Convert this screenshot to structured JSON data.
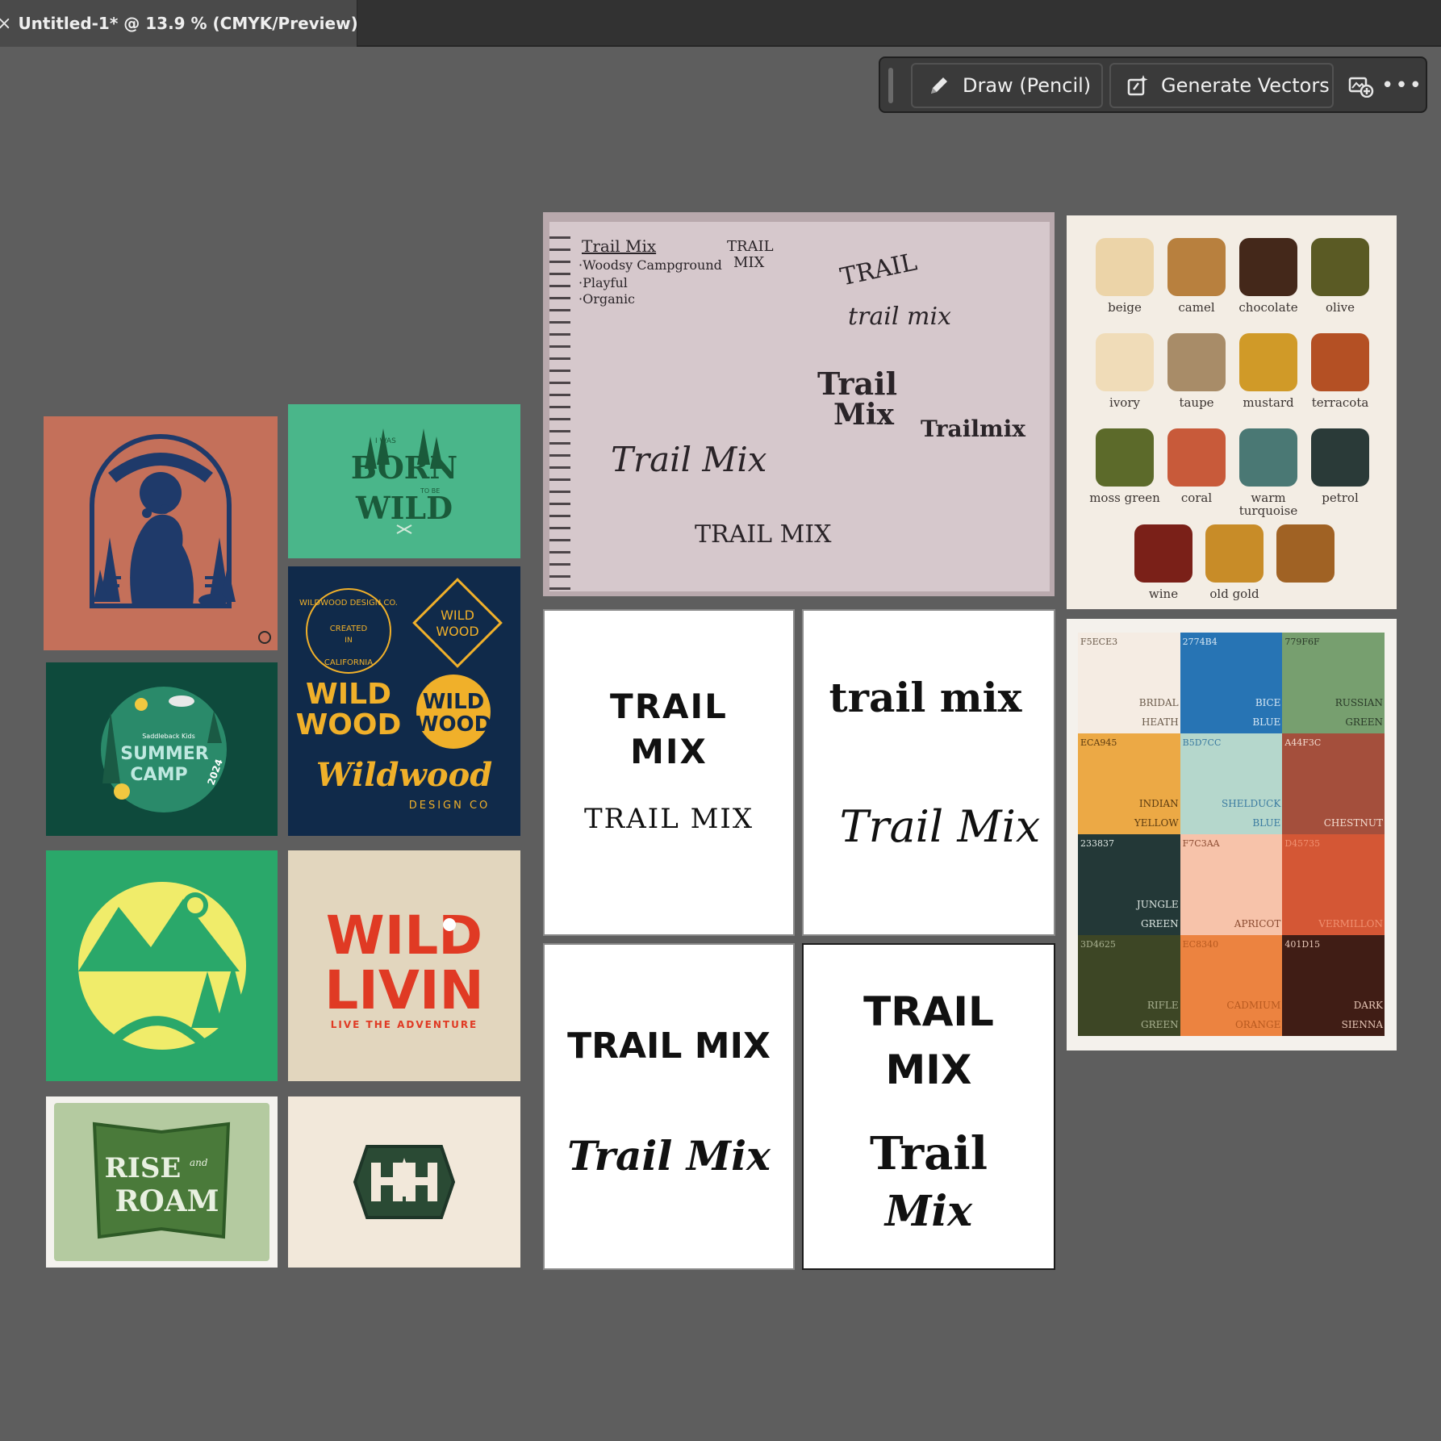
{
  "tab": {
    "close": "×",
    "title": "Untitled-1* @ 13.9 % (CMYK/Preview)"
  },
  "taskbar": {
    "draw_label": "Draw (Pencil)",
    "generate_label": "Generate Vectors",
    "more": "•••"
  },
  "sketch": {
    "title": "Trail Mix",
    "notes": [
      "·Woodsy Campground",
      "·Playful",
      "·Organic"
    ],
    "labels": [
      "TRAIL",
      "MIX",
      "TRAIL",
      "trail mix",
      "Trail Mix",
      "Trail",
      "Mix",
      "Trailmix",
      "TRAIL MIX"
    ]
  },
  "palette": {
    "swatches": [
      {
        "name": "beige",
        "color": "#ecd4a8"
      },
      {
        "name": "camel",
        "color": "#b8803e"
      },
      {
        "name": "chocolate",
        "color": "#44281a"
      },
      {
        "name": "olive",
        "color": "#5a5a24"
      },
      {
        "name": "ivory",
        "color": "#f0dcb8"
      },
      {
        "name": "taupe",
        "color": "#a88c68"
      },
      {
        "name": "mustard",
        "color": "#d09a28"
      },
      {
        "name": "terracota",
        "color": "#b45024"
      },
      {
        "name": "moss green",
        "color": "#5c6a2a"
      },
      {
        "name": "coral",
        "color": "#c85a3a"
      },
      {
        "name": "warm turquoise",
        "color": "#4a7874"
      },
      {
        "name": "petrol",
        "color": "#2a3a38"
      },
      {
        "name": "wine",
        "color": "#7a2018"
      },
      {
        "name": "old gold",
        "color": "#c88c28"
      },
      {
        "name": "",
        "color": "#a06224"
      }
    ]
  },
  "hexgrid": {
    "cells": [
      {
        "hex": "F5ECE3",
        "name1": "BRIDAL",
        "name2": "HEATH",
        "bg": "#f5ece3",
        "fg": "#6a5a4a"
      },
      {
        "hex": "2774B4",
        "name1": "BICE",
        "name2": "BLUE",
        "bg": "#2774b4",
        "fg": "#d8e8f4"
      },
      {
        "hex": "779F6F",
        "name1": "RUSSIAN",
        "name2": "GREEN",
        "bg": "#779f6f",
        "fg": "#2a3a28"
      },
      {
        "hex": "ECA945",
        "name1": "INDIAN",
        "name2": "YELLOW",
        "bg": "#eca945",
        "fg": "#5a3a10"
      },
      {
        "hex": "B5D7CC",
        "name1": "SHELDUCK",
        "name2": "BLUE",
        "bg": "#b5d7cc",
        "fg": "#3a7aa0"
      },
      {
        "hex": "A44F3C",
        "name1": "CHESTNUT",
        "name2": "",
        "bg": "#a44f3c",
        "fg": "#f4dcd0"
      },
      {
        "hex": "233837",
        "name1": "JUNGLE",
        "name2": "GREEN",
        "bg": "#233837",
        "fg": "#dfe8e4"
      },
      {
        "hex": "F7C3AA",
        "name1": "APRICOT",
        "name2": "",
        "bg": "#f7c3aa",
        "fg": "#8a4a30"
      },
      {
        "hex": "D45735",
        "name1": "VERMILLON",
        "name2": "",
        "bg": "#d45735",
        "fg": "#f09070"
      },
      {
        "hex": "3D4625",
        "name1": "RIFLE",
        "name2": "GREEN",
        "bg": "#3d4625",
        "fg": "#a8b090"
      },
      {
        "hex": "EC8340",
        "name1": "CADMIUM",
        "name2": "ORANGE",
        "bg": "#ec8340",
        "fg": "#b85a20"
      },
      {
        "hex": "401D15",
        "name1": "DARK",
        "name2": "SIENNA",
        "bg": "#401d15",
        "fg": "#e8c8b8"
      }
    ]
  },
  "type_cards": {
    "c1": {
      "a": "TRAIL",
      "b": "MIX",
      "c": "TRAIL MIX"
    },
    "c2": {
      "a": "trail mix",
      "b": "Trail Mix"
    },
    "c3": {
      "a": "TRAIL MIX",
      "b": "Trail Mix"
    },
    "c4": {
      "a": "TRAIL",
      "b": "MIX",
      "c": "Trail",
      "d": "Mix"
    }
  },
  "inspiration": {
    "born": {
      "l1": "I WAS",
      "l2": "BORN",
      "l3": "TO BE",
      "l4": "WILD"
    },
    "summer": {
      "l0": "Saddleback Kids",
      "l1": "SUMMER",
      "l2": "CAMP",
      "l3": "2024"
    },
    "wildwood": {
      "ring": "WILDWOOD DESIGN CO.",
      "created": "CREATED",
      "in": "IN",
      "ca": "CALIFORNIA",
      "wild": "WILD",
      "wood": "WOOD",
      "script": "Wildwood",
      "sub": "DESIGN CO"
    },
    "wildlivin": {
      "l1": "WILD",
      "l2": "LIVIN",
      "l3": "LIVE THE ADVENTURE"
    },
    "rise": {
      "l1": "RISE",
      "l2": "and",
      "l3": "ROAM"
    }
  }
}
